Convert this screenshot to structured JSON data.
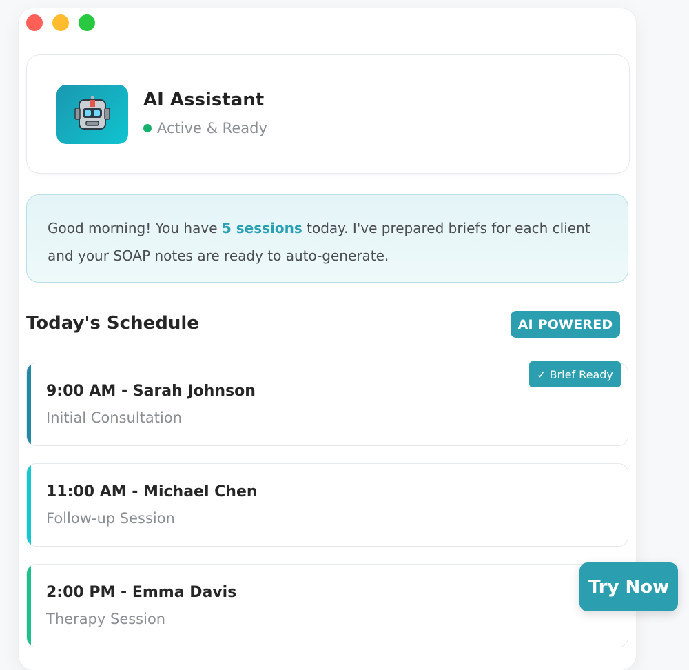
{
  "window": {
    "controls": [
      "close",
      "minimize",
      "maximize"
    ]
  },
  "assistant": {
    "title": "AI Assistant",
    "status": "Active & Ready",
    "icon": "robot-icon",
    "status_color": "#18b06e"
  },
  "greeting": {
    "before": "Good morning! You have ",
    "highlight": "5 sessions",
    "after": " today. I've prepared briefs for each client and your SOAP notes are ready to auto-generate."
  },
  "schedule": {
    "title": "Today's Schedule",
    "badge": "AI POWERED",
    "sessions": [
      {
        "title": "9:00 AM - Sarah Johnson",
        "type": "Initial Consultation",
        "accent": "#2389a3",
        "badge": "✓ Brief Ready"
      },
      {
        "title": "11:00 AM - Michael Chen",
        "type": "Follow-up Session",
        "accent": "#14c8d0"
      },
      {
        "title": "2:00 PM - Emma Davis",
        "type": "Therapy Session",
        "accent": "#1cc08a"
      }
    ]
  },
  "cta": {
    "label": "Try Now"
  },
  "colors": {
    "accent": "#2b9fb0"
  }
}
